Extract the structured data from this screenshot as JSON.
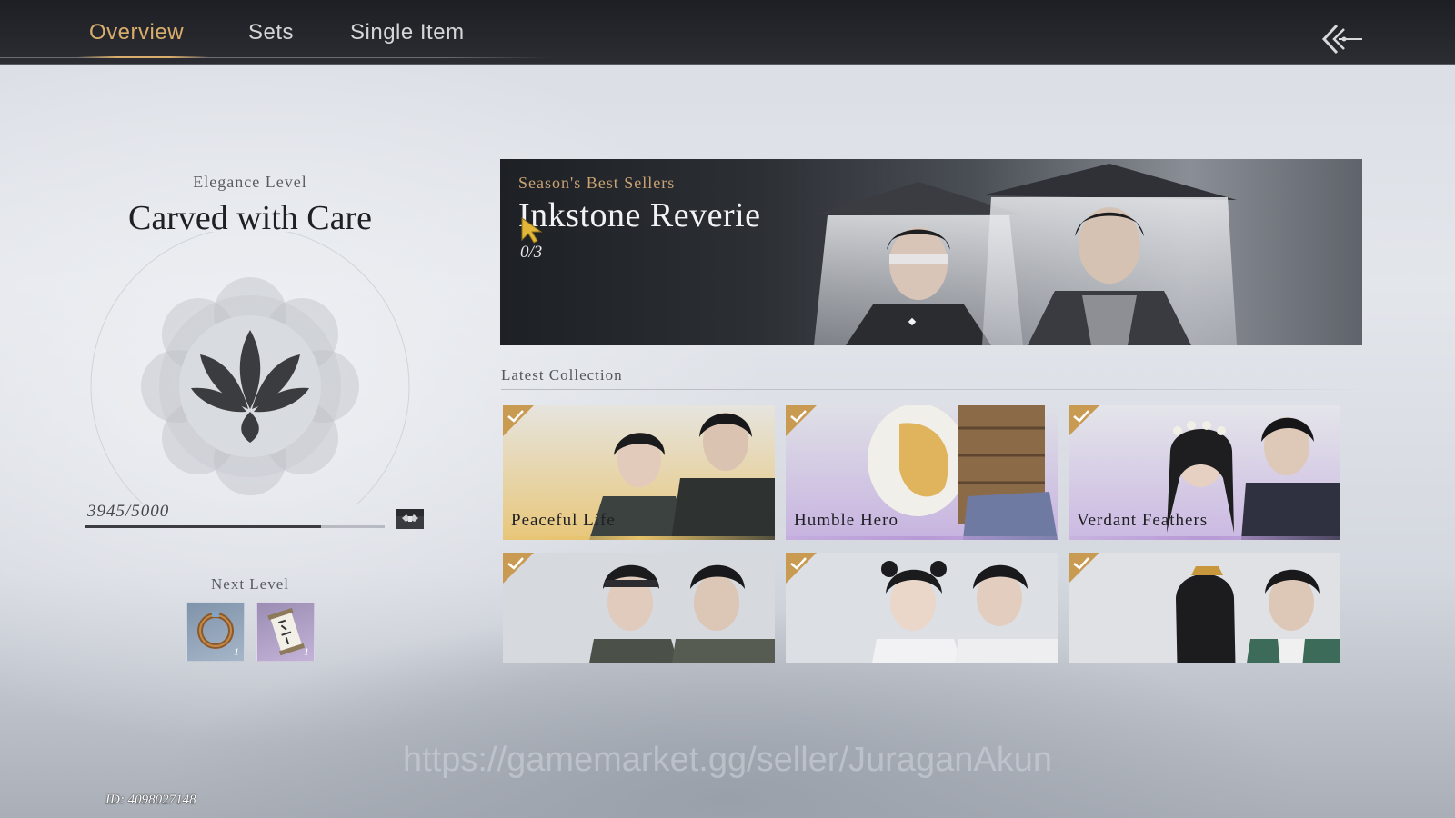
{
  "tabs": [
    {
      "label": "Overview",
      "active": true
    },
    {
      "label": "Sets",
      "active": false
    },
    {
      "label": "Single Item",
      "active": false
    }
  ],
  "icons": {
    "back": "double-chevron-left-icon",
    "chest": "chest-icon",
    "check": "check-icon",
    "cursor": "cursor-arrow-icon"
  },
  "elegance": {
    "label": "Elegance Level",
    "title": "Carved with Care",
    "progress_text": "3945/5000",
    "progress_value": 3945,
    "progress_max": 5000
  },
  "next_level": {
    "label": "Next Level",
    "rewards": [
      {
        "icon": "bracelet-icon",
        "qty": "1"
      },
      {
        "icon": "scroll-icon",
        "qty": "1"
      }
    ]
  },
  "banner": {
    "kicker": "Season's Best Sellers",
    "title": "Inkstone Reverie",
    "progress": "0/3"
  },
  "collection": {
    "label": "Latest Collection",
    "items": [
      {
        "name": "Peaceful Life",
        "owned": true,
        "accent": "#e6c26a"
      },
      {
        "name": "Humble Hero",
        "owned": true,
        "accent": "#b79ad6"
      },
      {
        "name": "Verdant Feathers",
        "owned": true,
        "accent": "#b79ad6"
      },
      {
        "name": "",
        "owned": true,
        "accent": "#9aa1a8"
      },
      {
        "name": "",
        "owned": true,
        "accent": "#9aa1a8"
      },
      {
        "name": "",
        "owned": true,
        "accent": "#9aa1a8"
      }
    ]
  },
  "colors": {
    "accent": "#d9ad6c",
    "check": "#c99a52"
  },
  "watermark": "https://gamemarket.gg/seller/JuraganAkun",
  "player_id": "ID: 4098027148"
}
